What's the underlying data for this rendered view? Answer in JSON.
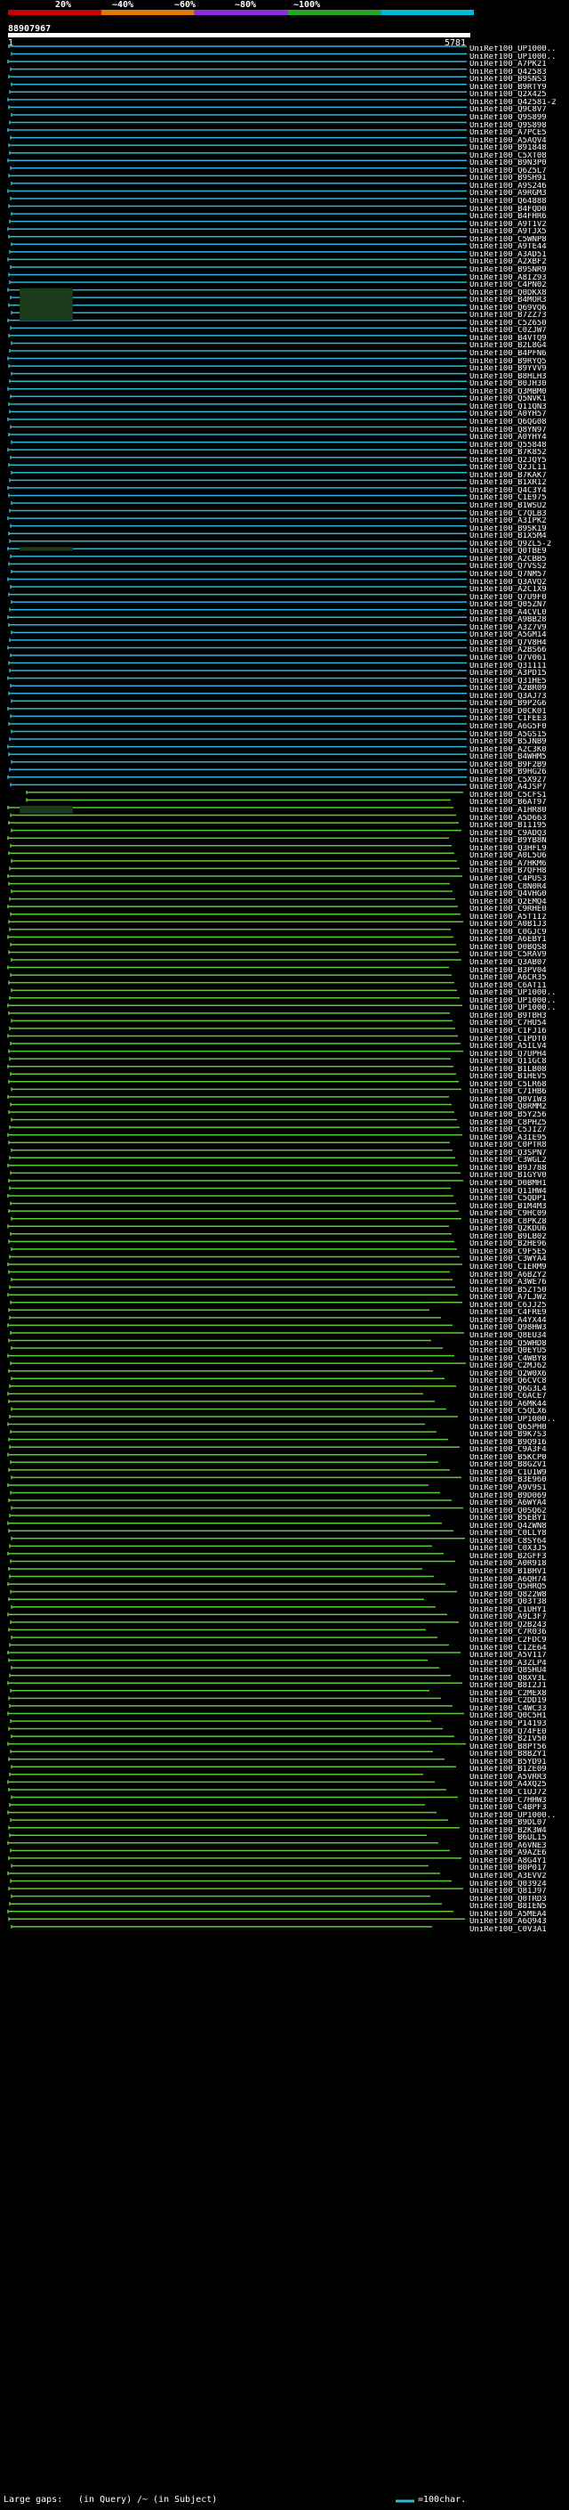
{
  "header": {
    "scale_labels": [
      "20%",
      "~40%",
      "~60%",
      "~80%",
      "~100%"
    ],
    "scale_colors": [
      "#cc0000",
      "#e07a00",
      "#8a2be2",
      "#22aa22",
      "#00b8d8"
    ],
    "query_id": "88907967",
    "query_start": "1",
    "query_end": "5781"
  },
  "colors": {
    "high_identity": "#2ab7d8",
    "mid_identity": "#5ccc3a",
    "gap": "#1a3a1a",
    "query_bar": "#ffffff"
  },
  "legend": {
    "text_left": "Large gaps:",
    "in_query": "(in Query)",
    "in_subject": "/~ (in Subject)",
    "scale_text": "=100char."
  },
  "hits": [
    "UniRef100_UP1000..",
    "UniRef100_UP1000..",
    "UniRef100_A7PK21",
    "UniRef100_Q42583",
    "UniRef100_B9SNS3",
    "UniRef100_B9RTY9",
    "UniRef100_Q2X425",
    "UniRef100_Q42581-2",
    "UniRef100_Q9C8V7",
    "UniRef100_Q9S899",
    "UniRef100_Q9S898",
    "UniRef100_A7PCE5",
    "UniRef100_A5AQV4",
    "UniRef100_B91848",
    "UniRef100_C5XT08",
    "UniRef100_B9N3P0",
    "UniRef100_Q6Z5L7",
    "UniRef100_B9SH91",
    "UniRef100_A9S246",
    "UniRef100_A9RGM3",
    "UniRef100_Q64888",
    "UniRef100_B4FQD0",
    "UniRef100_B4FHR6",
    "UniRef100_A9T1V2",
    "UniRef100_A9TJX5",
    "UniRef100_C5WNP8",
    "UniRef100_A9TE44",
    "UniRef100_A3AD51",
    "UniRef100_A2XBF2",
    "UniRef100_B9SNR9",
    "UniRef100_A8IZ93",
    "UniRef100_C4PN02",
    "UniRef100_Q0DKX8",
    "UniRef100_B4MOR3",
    "UniRef100_Q69VQ6",
    "UniRef100_B7ZZ73",
    "UniRef100_C5Z650",
    "UniRef100_C0ZJW7",
    "UniRef100_B4VTQ9",
    "UniRef100_B2L8G4",
    "UniRef100_B4PFN6",
    "UniRef100_B9RYQ5",
    "UniRef100_B9YVV9",
    "UniRef100_B8HLH3",
    "UniRef100_B0JH30",
    "UniRef100_Q3MBM0",
    "UniRef100_Q5NVK1",
    "UniRef100_Q11QN3",
    "UniRef100_A0YH57",
    "UniRef100_Q6QG08",
    "UniRef100_Q8YN97",
    "UniRef100_A0YHY4",
    "UniRef100_Q55848",
    "UniRef100_B7K852",
    "UniRef100_Q2JQY5",
    "UniRef100_Q2JL11",
    "UniRef100_B7KAK7",
    "UniRef100_B1XR12",
    "UniRef100_Q4C3Y4",
    "UniRef100_C1E975",
    "UniRef100_B1WSU2",
    "UniRef100_C7QLB3",
    "UniRef100_A3IPK2",
    "UniRef100_B9SK19",
    "UniRef100_B1X5M4",
    "UniRef100_Q9ZL5-2",
    "UniRef100_Q0TBE9",
    "UniRef100_A2CBB5",
    "UniRef100_Q7VSS2",
    "UniRef100_Q7NM57",
    "UniRef100_Q3AVQ2",
    "UniRef100_A2C1X9",
    "UniRef100_Q7U9F0",
    "UniRef100_Q05ZN7",
    "UniRef100_A4CVL0",
    "UniRef100_A9BB28",
    "UniRef100_A3Z7V9",
    "UniRef100_A5GM14",
    "UniRef100_Q7V8H4",
    "UniRef100_A2BS66",
    "UniRef100_Q7V061",
    "UniRef100_Q31111",
    "UniRef100_A3PD15",
    "UniRef100_Q31HE5",
    "UniRef100_A2BR09",
    "UniRef100_Q3AJ73",
    "UniRef100_B9P2G6",
    "UniRef100_D0CK01",
    "UniRef100_C1FEE3",
    "UniRef100_A6G5F0",
    "UniRef100_A5GS15",
    "UniRef100_B5JNB9",
    "UniRef100_A2C3K0",
    "UniRef100_B4WHM5",
    "UniRef100_B9F2B9",
    "UniRef100_B9HG26",
    "UniRef100_C5X927",
    "UniRef100_A4JSP7",
    "UniRef100_C5CFS1",
    "UniRef100_B6AT97",
    "UniRef100_A1HR80",
    "UniRef100_A5D663",
    "UniRef100_B11195",
    "UniRef100_C9ADQ3",
    "UniRef100_B9YB8N",
    "UniRef100_Q3HFL9",
    "UniRef100_A0L5U6",
    "UniRef100_A7HKM6",
    "UniRef100_B7QFH8",
    "UniRef100_C4PUS3",
    "UniRef100_C8N0R4",
    "UniRef100_Q4VHG0",
    "UniRef100_Q2EMQ4",
    "UniRef100_C9RHE0",
    "UniRef100_A5T1I2",
    "UniRef100_A0B1J3",
    "UniRef100_C0GJC9",
    "UniRef100_A6EBY1",
    "UniRef100_D0BQS8",
    "UniRef100_C5RAV9",
    "UniRef100_Q3AB07",
    "UniRef100_B3PV04",
    "UniRef100_A6CR35",
    "UniRef100_C6AT11",
    "UniRef100_UP1000..",
    "UniRef100_UP1000..",
    "UniRef100_UP1000..",
    "UniRef100_B9TBH3",
    "UniRef100_C7HU54",
    "UniRef100_C1FJ16",
    "UniRef100_C1PDT0",
    "UniRef100_A5ILV4",
    "UniRef100_Q7UPH4",
    "UniRef100_Q11GC8",
    "UniRef100_B1LB08",
    "UniRef100_B1HEV5",
    "UniRef100_C5LR68",
    "UniRef100_C7IHB6",
    "UniRef100_Q0VIW3",
    "UniRef100_Q8RMM2",
    "UniRef100_B5Y256",
    "UniRef100_C8PHZ5",
    "UniRef100_C5JIZ7",
    "UniRef100_A3IE95",
    "UniRef100_C0PTR8",
    "UniRef100_Q3SPN7",
    "UniRef100_C3WGL2",
    "UniRef100_B9J788",
    "UniRef100_B1GYV0",
    "UniRef100_D0BMH1",
    "UniRef100_Q11HW4",
    "UniRef100_C5QDP1",
    "UniRef100_B1M4M3",
    "UniRef100_C9HC09",
    "UniRef100_C8PKZ8",
    "UniRef100_Q2KDU6",
    "UniRef100_B9LB02",
    "UniRef100_B2HE96",
    "UniRef100_C9F5E5",
    "UniRef100_C3WYA4",
    "UniRef100_C1ERM9",
    "UniRef100_A6BZY2",
    "UniRef100_A3WE76",
    "UniRef100_B5ZT50",
    "UniRef100_A7LJW2",
    "UniRef100_C6JJ25",
    "UniRef100_C4FRE9",
    "UniRef100_A4YX44",
    "UniRef100_Q98HW3",
    "UniRef100_Q8EU34",
    "UniRef100_Q5WHD8",
    "UniRef100_Q0EYU5",
    "UniRef100_C4WBY8",
    "UniRef100_C2MJ62",
    "UniRef100_Q2W0X6",
    "UniRef100_Q6CVC8",
    "UniRef100_Q6G3L4",
    "UniRef100_C6ACE7",
    "UniRef100_A6MK44",
    "UniRef100_C5QLX6",
    "UniRef100_UP1000..",
    "UniRef100_Q65PH0",
    "UniRef100_B9K7S3",
    "UniRef100_B9Q916",
    "UniRef100_C9A3F4",
    "UniRef100_B5KCP0",
    "UniRef100_B8GZV1",
    "UniRef100_C1U1W9",
    "UniRef100_B3E960",
    "UniRef100_A9V9S1",
    "UniRef100_B9D069",
    "UniRef100_A6WYA4",
    "UniRef100_Q0SQ62",
    "UniRef100_B5EBY1",
    "UniRef100_Q4ZWN8",
    "UniRef100_C0LLY8",
    "UniRef100_C8SY64",
    "UniRef100_C0X3J5",
    "UniRef100_B2GFF3",
    "UniRef100_A0R918",
    "UniRef100_B1BHV1",
    "UniRef100_A6QH74",
    "UniRef100_Q5HRQ5",
    "UniRef100_Q822W8",
    "UniRef100_Q03T38",
    "UniRef100_C1UHY1",
    "UniRef100_A9L3F7",
    "UniRef100_Q2B243",
    "UniRef100_C7R036",
    "UniRef100_C2FDC9",
    "UniRef100_C1ZE64",
    "UniRef100_A5V117",
    "UniRef100_A3ZLP4",
    "UniRef100_Q8SHU4",
    "UniRef100_Q8XV3L",
    "UniRef100_B8I2J1",
    "UniRef100_C2MEX8",
    "UniRef100_C2DD19",
    "UniRef100_C4WC33",
    "UniRef100_Q0C5H1",
    "UniRef100_P14193",
    "UniRef100_Q74FE0",
    "UniRef100_B2IV50",
    "UniRef100_B8PT56",
    "UniRef100_B8BZY1",
    "UniRef100_B5YD91",
    "UniRef100_B1ZE09",
    "UniRef100_A5VRR3",
    "UniRef100_A4XQ25",
    "UniRef100_C1UJ72",
    "UniRef100_C7HHW3",
    "UniRef100_C4BPF3",
    "UniRef100_UP1000..",
    "UniRef100_B9DL07",
    "UniRef100_B2K3W4",
    "UniRef100_B6UL15",
    "UniRef100_A6VNE3",
    "UniRef100_A9AZE6",
    "UniRef100_A8G4Y1",
    "UniRef100_B0P017",
    "UniRef100_A3EVV2",
    "UniRef100_Q03924",
    "UniRef100_Q81J97",
    "UniRef100_Q0TRD3",
    "UniRef100_B8IEN5",
    "UniRef100_A5MEA4",
    "UniRef100_A6Q943",
    "UniRef100_C0V3A1"
  ]
}
